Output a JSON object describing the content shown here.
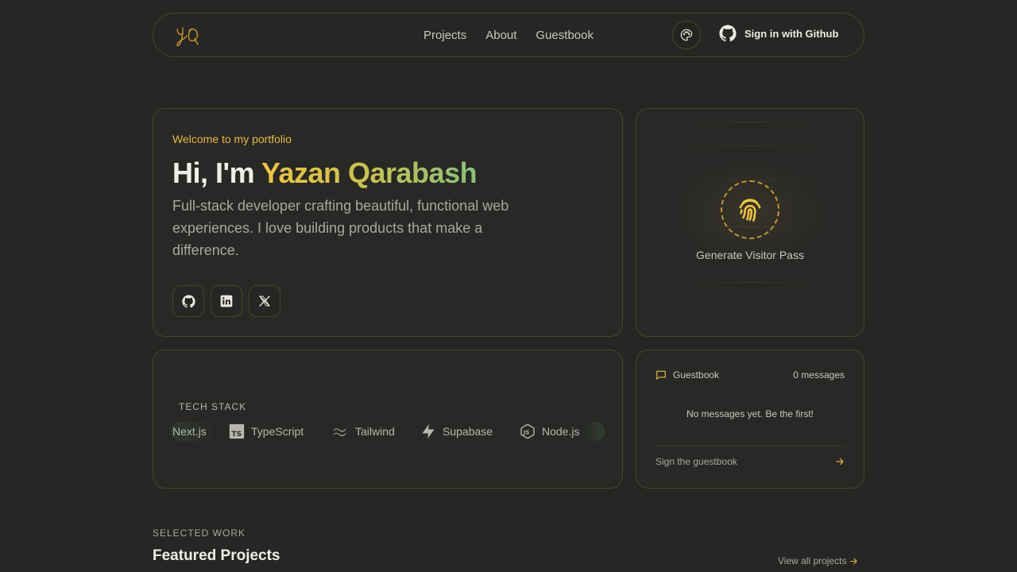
{
  "nav": {
    "links": [
      "Projects",
      "About",
      "Guestbook"
    ],
    "signin_label": "Sign in with Github"
  },
  "hero": {
    "welcome": "Welcome to my portfolio",
    "greeting": "Hi, I'm ",
    "name": "Yazan Qarabash",
    "description": "Full-stack developer crafting beautiful, functional web experiences. I love building products that make a difference.",
    "socials": [
      "github-icon",
      "linkedin-icon",
      "x-icon"
    ]
  },
  "visitor_pass": {
    "label": "Generate Visitor Pass"
  },
  "tech_stack": {
    "heading": "TECH STACK",
    "items": [
      "Next.js",
      "TypeScript",
      "Tailwind",
      "Supabase",
      "Node.js"
    ]
  },
  "guestbook": {
    "title": "Guestbook",
    "count": "0 messages",
    "empty": "No messages yet. Be the first!",
    "sign_label": "Sign the guestbook"
  },
  "selected_work": {
    "eyebrow": "SELECTED WORK",
    "title": "Featured Projects",
    "view_all": "View all projects"
  },
  "colors": {
    "accent": "#e8b93d",
    "border": "#4a4526",
    "background": "#262624"
  }
}
